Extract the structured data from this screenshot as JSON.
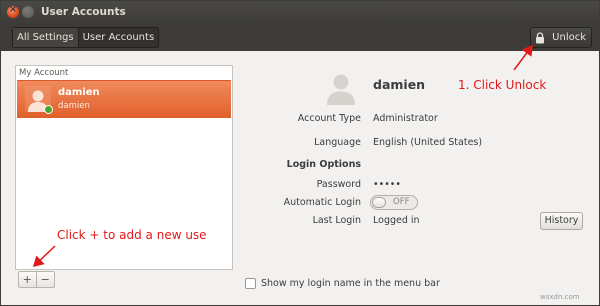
{
  "window": {
    "title": "User Accounts"
  },
  "toolbar": {
    "breadcrumb": [
      "All Settings",
      "User Accounts"
    ],
    "unlock_label": "Unlock"
  },
  "user_list": {
    "header": "My Account",
    "users": [
      {
        "name": "damien",
        "sub": "damien",
        "status": "online"
      }
    ],
    "add_label": "+",
    "remove_label": "−"
  },
  "details": {
    "name": "damien",
    "fields": [
      {
        "label": "Account Type",
        "value": "Administrator"
      },
      {
        "label": "Language",
        "value": "English (United States)"
      },
      {
        "label": "Login Options",
        "value": ""
      },
      {
        "label": "Password",
        "value": "•••••"
      },
      {
        "label": "Automatic Login",
        "value": "OFF"
      },
      {
        "label": "Last Login",
        "value": "Logged in"
      }
    ],
    "history_label": "History",
    "auto_login_on": false,
    "menubar_checkbox_label": "Show my login name in the menu bar",
    "menubar_checked": false
  },
  "annotations": {
    "unlock_note": "1. Click Unlock",
    "add_note": "Click + to add a new use"
  },
  "watermark": "wsxdn.com",
  "colors": {
    "selection": "#e0602b",
    "annotation": "#e0191a",
    "titlebar": "#3c3b37"
  }
}
